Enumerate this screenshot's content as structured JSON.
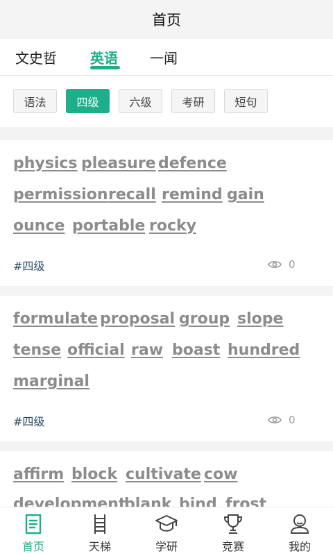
{
  "header": {
    "title": "首页"
  },
  "tabs": [
    {
      "label": "文史哲"
    },
    {
      "label": "英语"
    },
    {
      "label": "一闻"
    }
  ],
  "filters": [
    {
      "label": "语法"
    },
    {
      "label": "四级"
    },
    {
      "label": "六级"
    },
    {
      "label": "考研"
    },
    {
      "label": "短句"
    }
  ],
  "cards": [
    {
      "words": [
        "physics",
        "pleasure",
        "defence",
        "permission",
        "recall",
        "remind",
        "gain",
        "ounce",
        "portable",
        "rocky"
      ],
      "tag": "#四级",
      "views": "0"
    },
    {
      "words": [
        "formulate",
        "proposal",
        "group",
        "slope",
        "tense",
        "official",
        "raw",
        "boast",
        "hundred",
        "marginal"
      ],
      "tag": "#四级",
      "views": "0"
    },
    {
      "words": [
        "affirm",
        "block",
        "cultivate",
        "cow",
        "development",
        "blank",
        "bind",
        "frost"
      ]
    }
  ],
  "bottom_nav": [
    {
      "label": "首页",
      "icon": "home-doc-icon"
    },
    {
      "label": "天梯",
      "icon": "ladder-icon"
    },
    {
      "label": "学研",
      "icon": "graduation-cap-icon"
    },
    {
      "label": "竞赛",
      "icon": "trophy-icon"
    },
    {
      "label": "我的",
      "icon": "user-icon"
    }
  ],
  "colors": {
    "accent": "#1fae8a",
    "word": "#8c8c8c",
    "tag": "#2a4a63"
  }
}
